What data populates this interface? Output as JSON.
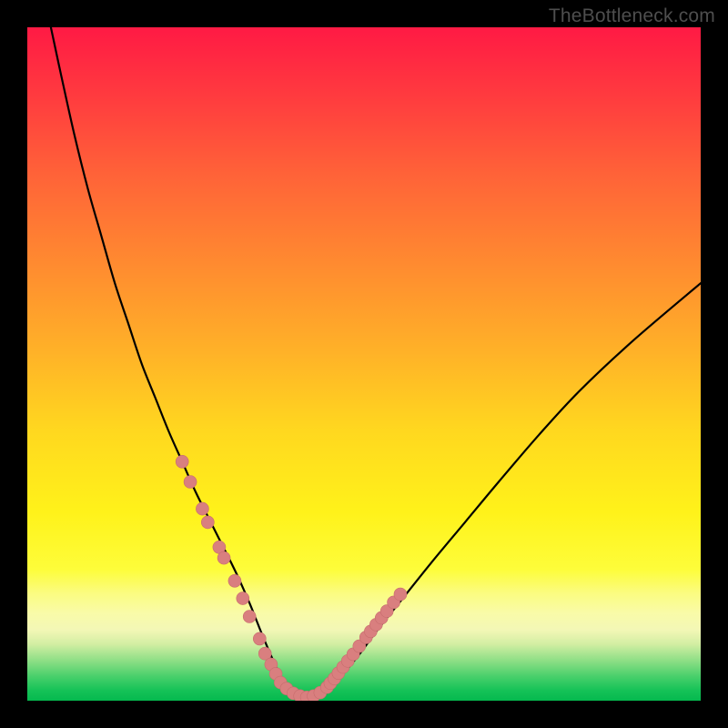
{
  "watermark": "TheBottleneck.com",
  "colors": {
    "frame": "#000000",
    "curve": "#000000",
    "marker_fill": "#d97f7f",
    "marker_stroke": "#c76d6d",
    "gradient_stops": [
      {
        "offset": 0.0,
        "color": "#ff1a44"
      },
      {
        "offset": 0.1,
        "color": "#ff3a3f"
      },
      {
        "offset": 0.22,
        "color": "#ff6338"
      },
      {
        "offset": 0.35,
        "color": "#ff8a30"
      },
      {
        "offset": 0.48,
        "color": "#ffb128"
      },
      {
        "offset": 0.6,
        "color": "#ffd81f"
      },
      {
        "offset": 0.72,
        "color": "#fff21a"
      },
      {
        "offset": 0.805,
        "color": "#fdfd3a"
      },
      {
        "offset": 0.84,
        "color": "#fbfc80"
      },
      {
        "offset": 0.87,
        "color": "#f9fba8"
      },
      {
        "offset": 0.895,
        "color": "#f3f7b6"
      },
      {
        "offset": 0.916,
        "color": "#d2eea3"
      },
      {
        "offset": 0.94,
        "color": "#8fdf86"
      },
      {
        "offset": 0.965,
        "color": "#46cf6a"
      },
      {
        "offset": 0.985,
        "color": "#15c257"
      },
      {
        "offset": 1.0,
        "color": "#05b94e"
      }
    ]
  },
  "chart_data": {
    "type": "line",
    "title": "",
    "xlabel": "",
    "ylabel": "",
    "xlim": [
      0,
      100
    ],
    "ylim": [
      0,
      100
    ],
    "note": "Values estimated from pixel positions; y is bottleneck percentage (0 = green/bottom, 100 = red/top).",
    "series": [
      {
        "name": "bottleneck-curve",
        "x": [
          3.5,
          5,
          7,
          9,
          11,
          13,
          15,
          17,
          19,
          21,
          23,
          25,
          27,
          29,
          31,
          33,
          34.8,
          36.5,
          38,
          40,
          42,
          44,
          46,
          49,
          52,
          56,
          60,
          65,
          70,
          76,
          82,
          90,
          100
        ],
        "y": [
          100,
          93,
          84,
          76,
          69,
          62,
          56,
          50,
          45,
          40,
          35.5,
          31,
          27,
          23,
          19,
          14.5,
          10,
          6,
          3,
          1.2,
          0.5,
          1.2,
          3,
          6.5,
          10.5,
          15.5,
          20.5,
          26.5,
          32.5,
          39.5,
          46,
          53.5,
          62
        ]
      }
    ],
    "markers": {
      "name": "highlight-dots",
      "note": "Salmon dots clustered on lower portion of curve.",
      "points": [
        {
          "x": 23.0,
          "y": 35.5
        },
        {
          "x": 24.2,
          "y": 32.5
        },
        {
          "x": 26.0,
          "y": 28.5
        },
        {
          "x": 26.8,
          "y": 26.5
        },
        {
          "x": 28.5,
          "y": 22.8
        },
        {
          "x": 29.2,
          "y": 21.2
        },
        {
          "x": 30.8,
          "y": 17.8
        },
        {
          "x": 32.0,
          "y": 15.2
        },
        {
          "x": 33.0,
          "y": 12.5
        },
        {
          "x": 34.5,
          "y": 9.2
        },
        {
          "x": 35.3,
          "y": 7.0
        },
        {
          "x": 36.2,
          "y": 5.4
        },
        {
          "x": 36.9,
          "y": 4.0
        },
        {
          "x": 37.6,
          "y": 2.7
        },
        {
          "x": 38.5,
          "y": 1.8
        },
        {
          "x": 39.5,
          "y": 1.1
        },
        {
          "x": 40.5,
          "y": 0.7
        },
        {
          "x": 41.5,
          "y": 0.5
        },
        {
          "x": 42.5,
          "y": 0.7
        },
        {
          "x": 43.5,
          "y": 1.2
        },
        {
          "x": 44.5,
          "y": 2.0
        },
        {
          "x": 45.0,
          "y": 2.6
        },
        {
          "x": 45.6,
          "y": 3.3
        },
        {
          "x": 46.2,
          "y": 4.1
        },
        {
          "x": 46.9,
          "y": 5.0
        },
        {
          "x": 47.6,
          "y": 5.9
        },
        {
          "x": 48.4,
          "y": 6.9
        },
        {
          "x": 49.3,
          "y": 8.1
        },
        {
          "x": 50.3,
          "y": 9.4
        },
        {
          "x": 51.0,
          "y": 10.3
        },
        {
          "x": 51.8,
          "y": 11.3
        },
        {
          "x": 52.6,
          "y": 12.3
        },
        {
          "x": 53.4,
          "y": 13.3
        },
        {
          "x": 54.4,
          "y": 14.6
        },
        {
          "x": 55.4,
          "y": 15.8
        }
      ]
    }
  }
}
